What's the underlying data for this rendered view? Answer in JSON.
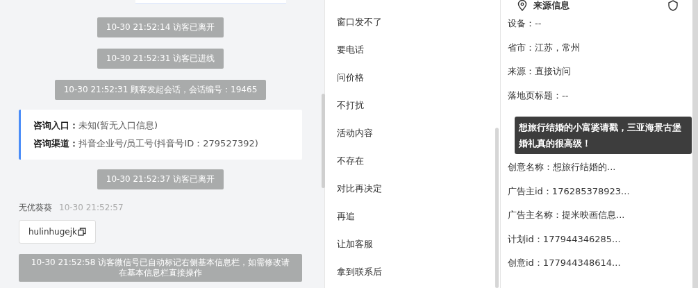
{
  "chat": {
    "messages": [
      {
        "kind": "system",
        "text": "10-30 21:52:14 访客已离开"
      },
      {
        "kind": "system",
        "text": "10-30 21:52:31 访客已进线"
      },
      {
        "kind": "system",
        "text": "10-30 21:52:31 顾客发起会话，会话编号：19465"
      },
      {
        "kind": "info",
        "lines": [
          {
            "label": "咨询入口：",
            "value": "未知(暂无入口信息)"
          },
          {
            "label": "咨询渠道：",
            "value": "抖音企业号/员工号(抖音号ID：279527392)"
          }
        ]
      },
      {
        "kind": "system",
        "text": "10-30 21:52:37 访客已离开"
      },
      {
        "kind": "agent",
        "name": "无优葵葵",
        "time": "10-30 21:52:57",
        "text": "hulinhugejk"
      },
      {
        "kind": "wide",
        "text": "10-30 21:52:58 访客微信号已自动标记右侧基本信息栏，如需修改请在基本信息栏直接操作"
      }
    ]
  },
  "tags": [
    "窗口发不了",
    "要电话",
    "问价格",
    "不打扰",
    "活动内容",
    "不存在",
    "对比再决定",
    "再追",
    "让加客服",
    "拿到联系后"
  ],
  "source": {
    "title": "来源信息",
    "rows": [
      {
        "text": "设备：--"
      },
      {
        "text": "省市：江苏，常州"
      },
      {
        "text": "来源：直接访问"
      },
      {
        "text": "落地页标题：--"
      },
      {
        "hidden": true
      },
      {
        "hidden": true
      },
      {
        "text": "创意名称：想旅行结婚的..."
      },
      {
        "text": "广告主id：176285378923..."
      },
      {
        "text": "广告主名称：提米映画信息..."
      },
      {
        "text": "计划id：177944346285..."
      },
      {
        "text": "创意id：177944348614..."
      }
    ],
    "tooltip": "想旅行结婚的小富婆请戳，三亚海景古堡婚礼真的很高级！"
  }
}
